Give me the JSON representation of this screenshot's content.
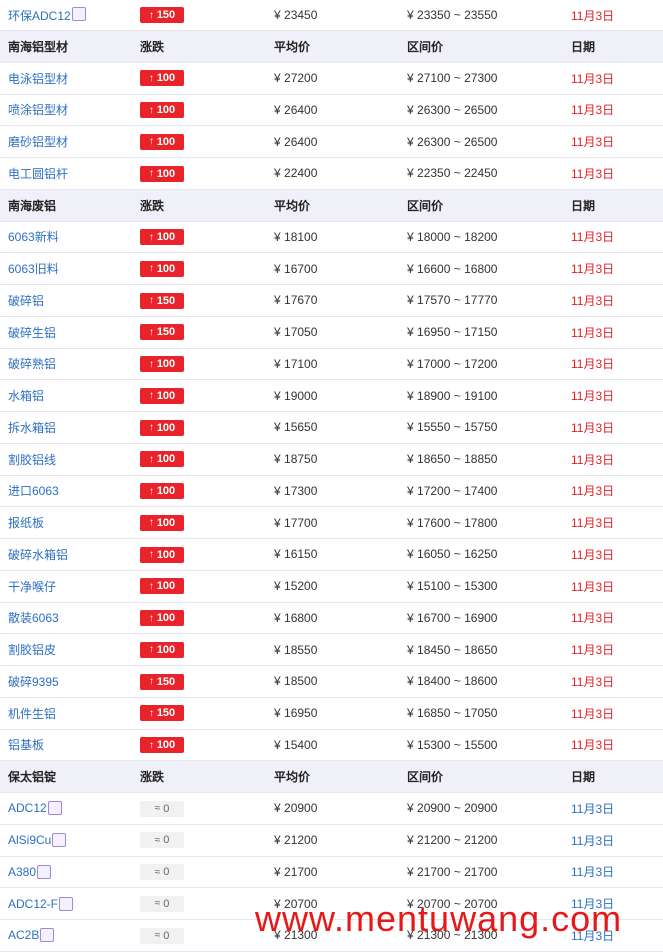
{
  "currency": "¥",
  "range_sep": "~",
  "watermark": "www.mentuwang.com",
  "rows": [
    {
      "type": "data",
      "name": "环保ADC12",
      "sym": true,
      "change": "150",
      "dir": "up",
      "avg": "23450",
      "lo": "23350",
      "hi": "23550",
      "date": "11月3日"
    },
    {
      "type": "header",
      "name": "南海铝型材",
      "change": "涨跌",
      "avg": "平均价",
      "range": "区间价",
      "date": "日期"
    },
    {
      "type": "data",
      "name": "电泳铝型材",
      "change": "100",
      "dir": "up",
      "avg": "27200",
      "lo": "27100",
      "hi": "27300",
      "date": "11月3日"
    },
    {
      "type": "data",
      "name": "喷涂铝型材",
      "change": "100",
      "dir": "up",
      "avg": "26400",
      "lo": "26300",
      "hi": "26500",
      "date": "11月3日"
    },
    {
      "type": "data",
      "name": "磨砂铝型材",
      "change": "100",
      "dir": "up",
      "avg": "26400",
      "lo": "26300",
      "hi": "26500",
      "date": "11月3日"
    },
    {
      "type": "data",
      "name": "电工圆铝杆",
      "change": "100",
      "dir": "up",
      "avg": "22400",
      "lo": "22350",
      "hi": "22450",
      "date": "11月3日"
    },
    {
      "type": "header",
      "name": "南海废铝",
      "change": "涨跌",
      "avg": "平均价",
      "range": "区间价",
      "date": "日期"
    },
    {
      "type": "data",
      "name": "6063新料",
      "change": "100",
      "dir": "up",
      "avg": "18100",
      "lo": "18000",
      "hi": "18200",
      "date": "11月3日"
    },
    {
      "type": "data",
      "name": "6063旧料",
      "change": "100",
      "dir": "up",
      "avg": "16700",
      "lo": "16600",
      "hi": "16800",
      "date": "11月3日"
    },
    {
      "type": "data",
      "name": "破碎铝",
      "change": "150",
      "dir": "up",
      "avg": "17670",
      "lo": "17570",
      "hi": "17770",
      "date": "11月3日"
    },
    {
      "type": "data",
      "name": "破碎生铝",
      "change": "150",
      "dir": "up",
      "avg": "17050",
      "lo": "16950",
      "hi": "17150",
      "date": "11月3日"
    },
    {
      "type": "data",
      "name": "破碎熟铝",
      "change": "100",
      "dir": "up",
      "avg": "17100",
      "lo": "17000",
      "hi": "17200",
      "date": "11月3日"
    },
    {
      "type": "data",
      "name": "水箱铝",
      "change": "100",
      "dir": "up",
      "avg": "19000",
      "lo": "18900",
      "hi": "19100",
      "date": "11月3日"
    },
    {
      "type": "data",
      "name": "拆水箱铝",
      "change": "100",
      "dir": "up",
      "avg": "15650",
      "lo": "15550",
      "hi": "15750",
      "date": "11月3日"
    },
    {
      "type": "data",
      "name": "割胶铝线",
      "change": "100",
      "dir": "up",
      "avg": "18750",
      "lo": "18650",
      "hi": "18850",
      "date": "11月3日"
    },
    {
      "type": "data",
      "name": "进口6063",
      "change": "100",
      "dir": "up",
      "avg": "17300",
      "lo": "17200",
      "hi": "17400",
      "date": "11月3日"
    },
    {
      "type": "data",
      "name": "报纸板",
      "change": "100",
      "dir": "up",
      "avg": "17700",
      "lo": "17600",
      "hi": "17800",
      "date": "11月3日"
    },
    {
      "type": "data",
      "name": "破碎水箱铝",
      "change": "100",
      "dir": "up",
      "avg": "16150",
      "lo": "16050",
      "hi": "16250",
      "date": "11月3日"
    },
    {
      "type": "data",
      "name": "干净喉仔",
      "change": "100",
      "dir": "up",
      "avg": "15200",
      "lo": "15100",
      "hi": "15300",
      "date": "11月3日"
    },
    {
      "type": "data",
      "name": "散装6063",
      "change": "100",
      "dir": "up",
      "avg": "16800",
      "lo": "16700",
      "hi": "16900",
      "date": "11月3日"
    },
    {
      "type": "data",
      "name": "割胶铝皮",
      "change": "100",
      "dir": "up",
      "avg": "18550",
      "lo": "18450",
      "hi": "18650",
      "date": "11月3日"
    },
    {
      "type": "data",
      "name": "破碎9395",
      "change": "150",
      "dir": "up",
      "avg": "18500",
      "lo": "18400",
      "hi": "18600",
      "date": "11月3日"
    },
    {
      "type": "data",
      "name": "机件生铝",
      "change": "150",
      "dir": "up",
      "avg": "16950",
      "lo": "16850",
      "hi": "17050",
      "date": "11月3日"
    },
    {
      "type": "data",
      "name": "铝基板",
      "change": "100",
      "dir": "up",
      "avg": "15400",
      "lo": "15300",
      "hi": "15500",
      "date": "11月3日"
    },
    {
      "type": "header",
      "name": "保太铝锭",
      "change": "涨跌",
      "avg": "平均价",
      "range": "区间价",
      "date": "日期"
    },
    {
      "type": "data",
      "name": "ADC12",
      "sym": true,
      "change": "0",
      "dir": "flat",
      "avg": "20900",
      "lo": "20900",
      "hi": "20900",
      "date": "11月3日"
    },
    {
      "type": "data",
      "name": "AlSi9Cu",
      "sym": true,
      "change": "0",
      "dir": "flat",
      "avg": "21200",
      "lo": "21200",
      "hi": "21200",
      "date": "11月3日"
    },
    {
      "type": "data",
      "name": "A380",
      "sym": true,
      "change": "0",
      "dir": "flat",
      "avg": "21700",
      "lo": "21700",
      "hi": "21700",
      "date": "11月3日"
    },
    {
      "type": "data",
      "name": "ADC12-F",
      "sym": true,
      "change": "0",
      "dir": "flat",
      "avg": "20700",
      "lo": "20700",
      "hi": "20700",
      "date": "11月3日"
    },
    {
      "type": "data",
      "name": "AC2B",
      "sym": true,
      "change": "0",
      "dir": "flat",
      "avg": "21300",
      "lo": "21300",
      "hi": "21300",
      "date": "11月3日"
    }
  ]
}
